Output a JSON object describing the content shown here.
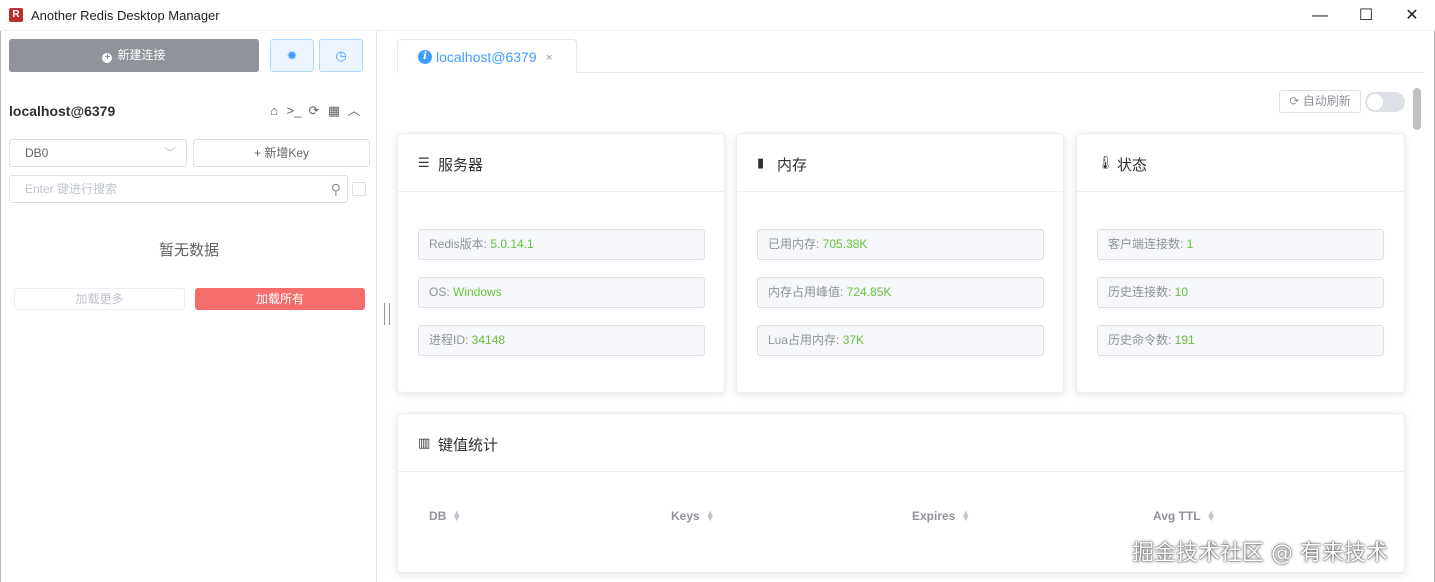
{
  "window": {
    "app_icon": "redis-icon",
    "title": "Another Redis Desktop Manager",
    "minimize": "—",
    "maximize": "☐",
    "close": "✕"
  },
  "sidebar": {
    "new_connection_label": "新建连接",
    "settings_icon": "gear-icon",
    "history_icon": "clock-icon",
    "connection_name": "localhost@6379",
    "connection_actions": [
      "home-icon",
      "terminal-icon",
      "refresh-icon",
      "grid-icon",
      "collapse-icon"
    ],
    "db_select_value": "DB0",
    "new_key_label": "+ 新增Key",
    "search_placeholder": "Enter 键进行搜索",
    "empty_text": "暂无数据",
    "load_more_label": "加载更多",
    "load_all_label": "加载所有"
  },
  "main": {
    "tab_label": "localhost@6379",
    "tab_close": "×",
    "auto_refresh_label": "自动刷新",
    "auto_refresh_on": false,
    "server_card": {
      "title": "服务器",
      "icon": "server-icon",
      "rows": [
        {
          "label": "Redis版本: ",
          "value": "5.0.14.1"
        },
        {
          "label": "OS: ",
          "value": "Windows"
        },
        {
          "label": "进程ID: ",
          "value": "34148"
        }
      ]
    },
    "memory_card": {
      "title": "内存",
      "icon": "memory-chip-icon",
      "rows": [
        {
          "label": "已用内存: ",
          "value": "705.38K"
        },
        {
          "label": "内存占用峰值: ",
          "value": "724.85K"
        },
        {
          "label": "Lua占用内存: ",
          "value": "37K"
        }
      ]
    },
    "status_card": {
      "title": "状态",
      "icon": "thermometer-icon",
      "rows": [
        {
          "label": "客户端连接数: ",
          "value": "1"
        },
        {
          "label": "历史连接数: ",
          "value": "10"
        },
        {
          "label": "历史命令数: ",
          "value": "191"
        }
      ]
    },
    "keys_card": {
      "title": "键值统计",
      "icon": "bar-chart-icon",
      "columns": [
        "DB",
        "Keys",
        "Expires",
        "Avg TTL"
      ]
    }
  },
  "watermark": "掘金技术社区 @ 有来技术",
  "colors": {
    "accent": "#409eff",
    "value_green": "#67c23a",
    "danger": "#f56c6c",
    "neutral_button": "#909399"
  }
}
